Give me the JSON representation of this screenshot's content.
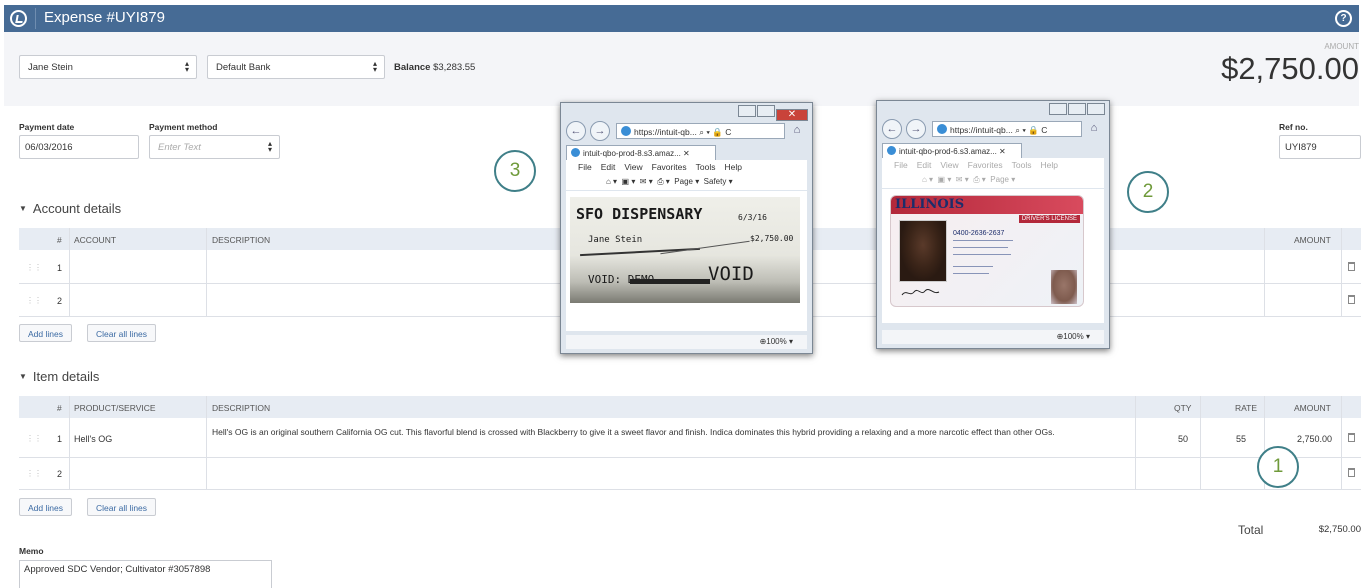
{
  "header": {
    "title": "Expense #UYI879"
  },
  "payee": {
    "name": "Jane Stein",
    "account": "Default Bank",
    "balance_label": "Balance",
    "balance_value": "$3,283.55"
  },
  "amount": {
    "label": "AMOUNT",
    "value": "$2,750.00"
  },
  "payment": {
    "date_label": "Payment date",
    "date_value": "06/03/2016",
    "method_label": "Payment method",
    "method_placeholder": "Enter Text",
    "ref_label": "Ref no.",
    "ref_value": "UYI879"
  },
  "account_details": {
    "title": "Account details",
    "columns": [
      "#",
      "ACCOUNT",
      "DESCRIPTION",
      "AMOUNT"
    ],
    "rows": [
      {
        "num": "1"
      },
      {
        "num": "2"
      }
    ],
    "add_lines": "Add lines",
    "clear_lines": "Clear all lines"
  },
  "item_details": {
    "title": "Item details",
    "columns": [
      "#",
      "PRODUCT/SERVICE",
      "DESCRIPTION",
      "QTY",
      "RATE",
      "AMOUNT"
    ],
    "rows": [
      {
        "num": "1",
        "product": "Hell's OG",
        "description": "Hell's OG is an original southern California OG cut. This flavorful blend is crossed with Blackberry to give it a sweet flavor and finish. Indica dominates this hybrid providing a relaxing and a more narcotic effect than other OGs.",
        "qty": "50",
        "rate": "55",
        "amount": "2,750.00"
      },
      {
        "num": "2"
      }
    ],
    "add_lines": "Add lines",
    "clear_lines": "Clear all lines"
  },
  "totals": {
    "label": "Total",
    "value": "$2,750.00"
  },
  "memo": {
    "label": "Memo",
    "value": "Approved SDC Vendor; Cultivator #3057898"
  },
  "popup_receipt": {
    "address": "https://intuit-qb...",
    "tab": "intuit-qbo-prod-8.s3.amaz...",
    "menu": [
      "File",
      "Edit",
      "View",
      "Favorites",
      "Tools",
      "Help"
    ],
    "commands": [
      "Page",
      "Safety"
    ],
    "zoom": "100%",
    "receipt_lines": [
      "SFO DISPENSARY",
      "6/3/16",
      "Jane Stein",
      "$2,750.00",
      "VOID: DEMO",
      "VOID"
    ]
  },
  "popup_license": {
    "address": "https://intuit-qb...",
    "tab": "intuit-qbo-prod-6.s3.amaz...",
    "menu": [
      "File",
      "Edit",
      "View",
      "Favorites",
      "Tools",
      "Help"
    ],
    "commands": [
      "Page"
    ],
    "zoom": "100%",
    "license_state": "ILLINOIS",
    "license_type": "DRIVER'S LICENSE",
    "license_number": "0400-2636-2637"
  },
  "callouts": [
    "3",
    "2",
    "1"
  ]
}
